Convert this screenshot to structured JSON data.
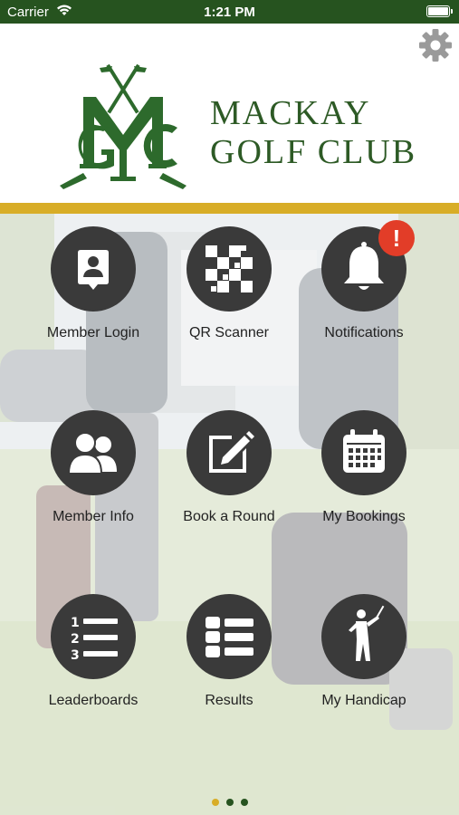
{
  "status_bar": {
    "carrier": "Carrier",
    "time": "1:21 PM"
  },
  "header": {
    "club_name_line1": "MACKAY",
    "club_name_line2": "GOLF CLUB",
    "logo_icon": "mgc-monogram-logo-icon",
    "settings_icon": "gear-icon"
  },
  "colors": {
    "brand_green": "#26531f",
    "accent_gold": "#d8ad27",
    "tile_circle": "#3a3a3a",
    "badge_red": "#e23d28"
  },
  "menu": {
    "items": [
      {
        "label": "Member Login",
        "icon": "member-card-icon"
      },
      {
        "label": "QR Scanner",
        "icon": "qr-code-icon"
      },
      {
        "label": "Notifications",
        "icon": "bell-icon",
        "badge": "!"
      },
      {
        "label": "Member Info",
        "icon": "members-icon"
      },
      {
        "label": "Book a Round",
        "icon": "edit-pencil-icon"
      },
      {
        "label": "My Bookings",
        "icon": "calendar-icon"
      },
      {
        "label": "Leaderboards",
        "icon": "numbered-list-icon"
      },
      {
        "label": "Results",
        "icon": "results-list-icon"
      },
      {
        "label": "My Handicap",
        "icon": "golfer-icon"
      }
    ]
  },
  "pagination": {
    "pages": 3,
    "current": 1
  }
}
